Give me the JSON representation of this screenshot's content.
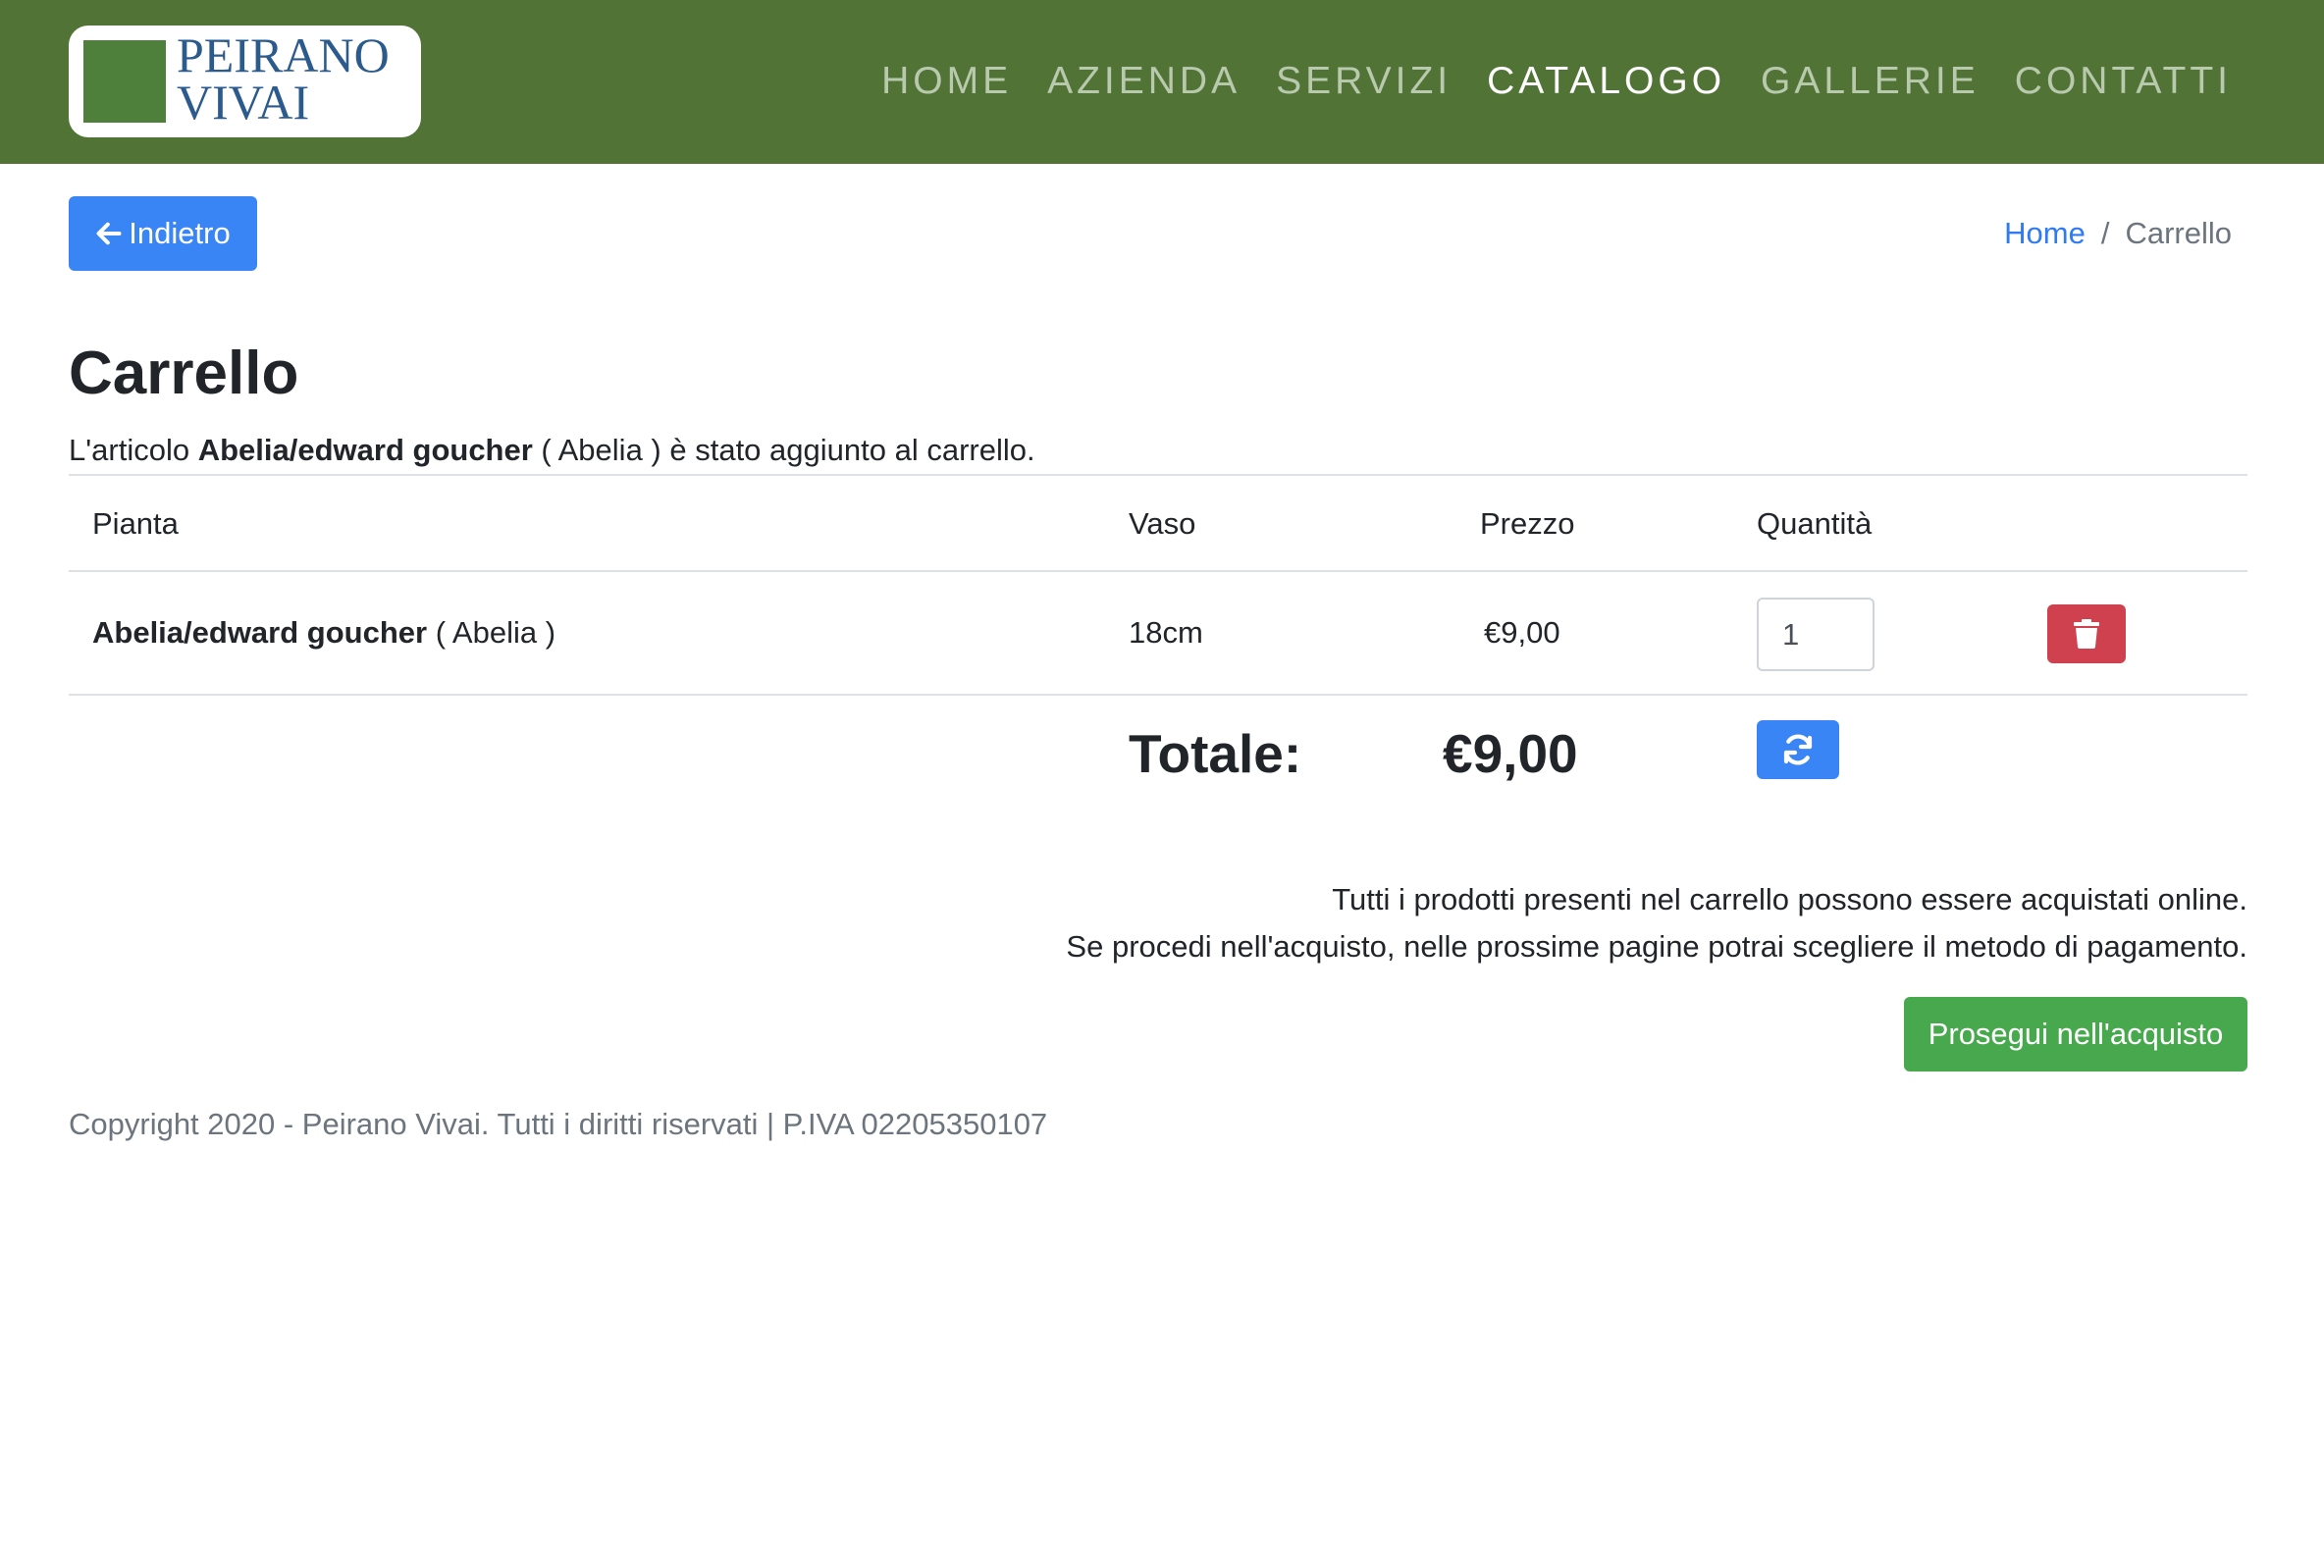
{
  "brand": {
    "logo_line1": "PEIRANO",
    "logo_line2": "VIVAI"
  },
  "nav": {
    "items": [
      {
        "label": "HOME",
        "active": false
      },
      {
        "label": "AZIENDA",
        "active": false
      },
      {
        "label": "SERVIZI",
        "active": false
      },
      {
        "label": "CATALOGO",
        "active": true
      },
      {
        "label": "GALLERIE",
        "active": false
      },
      {
        "label": "CONTATTI",
        "active": false
      }
    ]
  },
  "back_button": {
    "label": "Indietro",
    "icon": "arrow-left-icon"
  },
  "breadcrumb": {
    "home": "Home",
    "separator": "/",
    "current": "Carrello"
  },
  "page": {
    "title": "Carrello",
    "added_prefix": "L'articolo ",
    "added_item": "Abelia/edward goucher",
    "added_suffix": " ( Abelia ) è stato aggiunto al carrello."
  },
  "cart_table": {
    "headers": {
      "plant": "Pianta",
      "pot": "Vaso",
      "price": "Prezzo",
      "quantity": "Quantità"
    },
    "rows": [
      {
        "plant_name": "Abelia/edward goucher",
        "plant_genus": " ( Abelia )",
        "pot": "18cm",
        "price": "€9,00",
        "quantity": "1"
      }
    ],
    "total_label": "Totale:",
    "total_value": "€9,00"
  },
  "info": {
    "line1": "Tutti i prodotti presenti nel carrello possono essere acquistati online.",
    "line2": "Se procedi nell'acquisto, nelle prossime pagine potrai scegliere il metodo di pagamento."
  },
  "proceed_button": {
    "label": "Prosegui nell'acquisto"
  },
  "footer": {
    "text": "Copyright 2020 - Peirano Vivai. Tutti i diritti riservati | P.IVA 02205350107"
  },
  "colors": {
    "header_bg": "#517436",
    "primary": "#3a85f6",
    "danger": "#d0414f",
    "success": "#48a84e",
    "logo_text": "#2b5a8c"
  }
}
